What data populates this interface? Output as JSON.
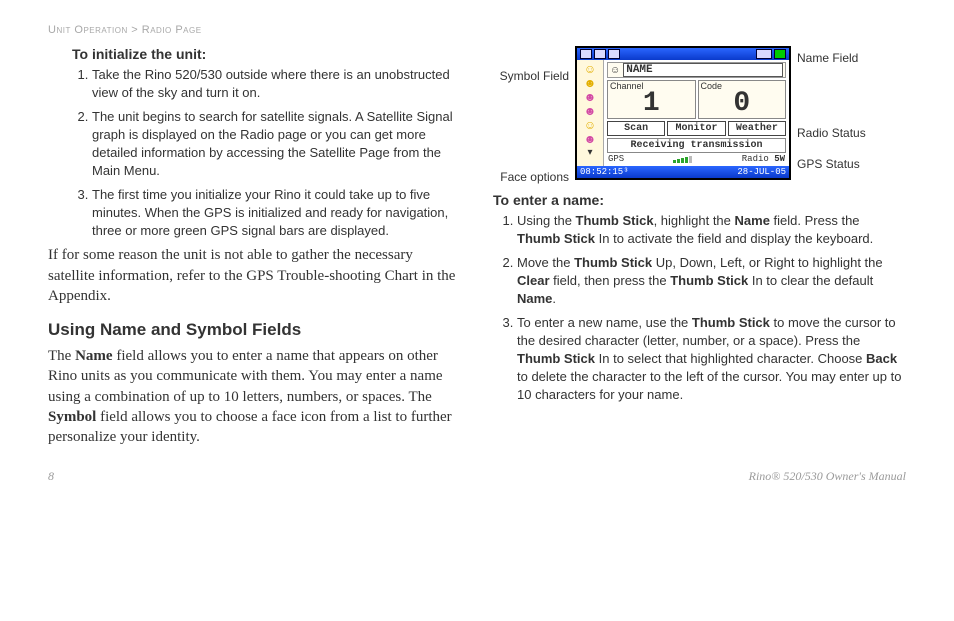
{
  "kicker": "Unit Operation > Radio Page",
  "left": {
    "subhead1": "To initialize the unit:",
    "step1": "Take the Rino 520/530 outside where there is an unobstructed view of the sky and turn it on.",
    "step2": "The unit begins to search for satellite signals. A Satellite Signal graph is displayed on the Radio page or you can get more detailed information by accessing the Satellite Page from the Main Menu.",
    "step3": "The first time you initialize your Rino it could take up to five minutes. When the GPS is initialized and ready for navigation, three or more green GPS signal bars are displayed.",
    "para1": "If for some reason the unit is not able to gather the necessary satellite information, refer to the GPS Trouble-shooting Chart in the Appendix.",
    "section": "Using Name and Symbol Fields",
    "para2a": "The ",
    "para2b": " field allows you to enter a name that appears on other Rino units as you communicate with them. You may enter a name using a combination of up to 10 letters, numbers, or spaces. The ",
    "para2c": " field allows you to choose a face icon from a list to further personalize your identity.",
    "bold_name": "Name",
    "bold_symbol": "Symbol"
  },
  "right": {
    "subhead2": "To enter a name:",
    "s1a": "Using the ",
    "s1b": "Thumb Stick",
    "s1c": ", highlight the ",
    "s1d": "Name",
    "s1e": " field. Press the ",
    "s1f": "Thumb Stick",
    "s1g": " In to activate the field and display the keyboard.",
    "s2a": "Move the ",
    "s2b": "Thumb Stick",
    "s2c": " Up, Down, Left, or Right to highlight the ",
    "s2d": "Clear",
    "s2e": " field, then press the ",
    "s2f": "Thumb Stick",
    "s2g": " In to clear the default ",
    "s2h": "Name",
    "s2i": ".",
    "s3a": "To enter a new name, use the ",
    "s3b": "Thumb Stick",
    "s3c": " to move the cursor to the desired character (letter, number, or a space). Press the ",
    "s3d": "Thumb Stick",
    "s3e": " In to select that highlighted character. Choose ",
    "s3f": "Back",
    "s3g": " to delete the character to the left of the cursor. You may enter up to 10 characters for your name."
  },
  "labels": {
    "symbol_field": "Symbol Field",
    "face_options": "Face options",
    "name_field": "Name Field",
    "radio_status": "Radio Status",
    "gps_status": "GPS Status"
  },
  "device": {
    "name": "NAME",
    "channel_cap": "Channel",
    "code_cap": "Code",
    "channel": "1",
    "code": "0",
    "btn_scan": "Scan",
    "btn_monitor": "Monitor",
    "btn_weather": "Weather",
    "recv": "Receiving transmission",
    "gps": "GPS",
    "radio": "Radio",
    "radio_val": "5W",
    "time": "08:52:15³",
    "date": "28-JUL-05"
  },
  "footer": {
    "page": "8",
    "manual": "Rino® 520/530 Owner's Manual"
  }
}
